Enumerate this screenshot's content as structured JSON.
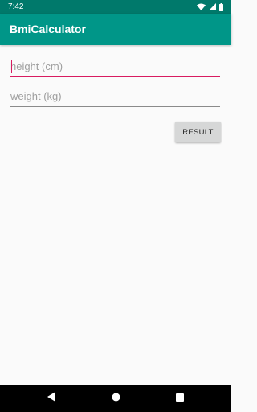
{
  "status_bar": {
    "time": "7:42",
    "icons": [
      "wifi-icon",
      "signal-icon",
      "battery-icon"
    ]
  },
  "app_bar": {
    "title": "BmiCalculator",
    "color": "#009688",
    "status_color": "#00796b"
  },
  "form": {
    "height_placeholder": "height (cm)",
    "height_value": "",
    "weight_placeholder": "weight (kg)",
    "weight_value": "",
    "focus_color": "#d81b60"
  },
  "result_button": {
    "label": "RESULT"
  },
  "nav_bar": {
    "icons": [
      "back-icon",
      "home-icon",
      "recents-icon"
    ]
  }
}
